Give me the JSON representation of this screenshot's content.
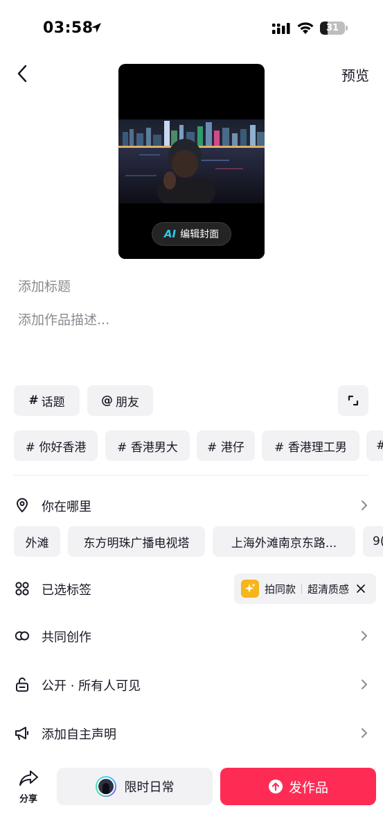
{
  "status_bar": {
    "time": "03:58",
    "battery": "31",
    "battery_level": 0.31
  },
  "header": {
    "preview_label": "预览"
  },
  "cover": {
    "ai_badge": "AI",
    "edit_label": "编辑封面"
  },
  "inputs": {
    "title_placeholder": "添加标题",
    "description_placeholder": "添加作品描述..."
  },
  "quick_actions": [
    {
      "symbol": "#",
      "label": "话题"
    },
    {
      "symbol": "@",
      "label": "朋友"
    }
  ],
  "hashtags": [
    "# 你好香港",
    "# 香港男大",
    "# 港仔",
    "# 香港理工男",
    "#"
  ],
  "location": {
    "label": "你在哪里",
    "suggestions": [
      "外滩",
      "东方明珠广播电视塔",
      "上海外滩南京东路...",
      "9("
    ]
  },
  "selected_tags": {
    "label": "已选标签",
    "tag_main": "拍同款",
    "tag_sub": "超清质感"
  },
  "co_create": {
    "label": "共同创作"
  },
  "visibility": {
    "label": "公开 · 所有人可见"
  },
  "declaration": {
    "label": "添加自主声明"
  },
  "bottom_bar": {
    "share_label": "分享",
    "daily_label": "限时日常",
    "publish_label": "发作品"
  },
  "colors": {
    "publish": "#fe2c55",
    "chip_bg": "#f2f2f4",
    "ai_accent": "#2ec8e8",
    "tag_icon": "#f5b51b"
  }
}
